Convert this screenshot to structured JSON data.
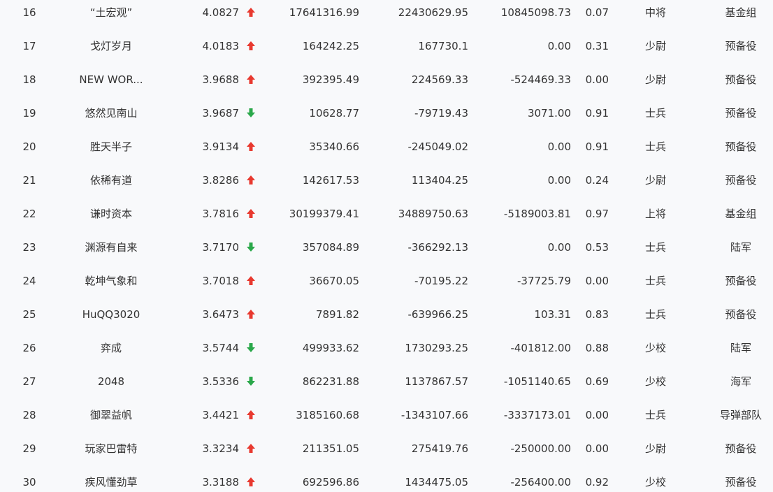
{
  "colors": {
    "up": "#e8392f",
    "down": "#2aa84a"
  },
  "rows": [
    {
      "rank": "16",
      "name": "“土宏观”",
      "score": "4.0827",
      "trend": "up",
      "v1": "17641316.99",
      "v2": "22430629.95",
      "v3": "10845098.73",
      "v4": "0.07",
      "title": "中将",
      "group": "基金组"
    },
    {
      "rank": "17",
      "name": "戈灯岁月",
      "score": "4.0183",
      "trend": "up",
      "v1": "164242.25",
      "v2": "167730.1",
      "v3": "0.00",
      "v4": "0.31",
      "title": "少尉",
      "group": "预备役"
    },
    {
      "rank": "18",
      "name": "NEW WOR...",
      "score": "3.9688",
      "trend": "up",
      "v1": "392395.49",
      "v2": "224569.33",
      "v3": "-524469.33",
      "v4": "0.00",
      "title": "少尉",
      "group": "预备役"
    },
    {
      "rank": "19",
      "name": "悠然见南山",
      "score": "3.9687",
      "trend": "down",
      "v1": "10628.77",
      "v2": "-79719.43",
      "v3": "3071.00",
      "v4": "0.91",
      "title": "士兵",
      "group": "预备役"
    },
    {
      "rank": "20",
      "name": "胜天半子",
      "score": "3.9134",
      "trend": "up",
      "v1": "35340.66",
      "v2": "-245049.02",
      "v3": "0.00",
      "v4": "0.91",
      "title": "士兵",
      "group": "预备役"
    },
    {
      "rank": "21",
      "name": "依稀有道",
      "score": "3.8286",
      "trend": "up",
      "v1": "142617.53",
      "v2": "113404.25",
      "v3": "0.00",
      "v4": "0.24",
      "title": "少尉",
      "group": "预备役"
    },
    {
      "rank": "22",
      "name": "谦时资本",
      "score": "3.7816",
      "trend": "up",
      "v1": "30199379.41",
      "v2": "34889750.63",
      "v3": "-5189003.81",
      "v4": "0.97",
      "title": "上将",
      "group": "基金组"
    },
    {
      "rank": "23",
      "name": "渊源有自来",
      "score": "3.7170",
      "trend": "down",
      "v1": "357084.89",
      "v2": "-366292.13",
      "v3": "0.00",
      "v4": "0.53",
      "title": "士兵",
      "group": "陆军"
    },
    {
      "rank": "24",
      "name": "乾坤气象和",
      "score": "3.7018",
      "trend": "up",
      "v1": "36670.05",
      "v2": "-70195.22",
      "v3": "-37725.79",
      "v4": "0.00",
      "title": "士兵",
      "group": "预备役"
    },
    {
      "rank": "25",
      "name": "HuQQ3020",
      "score": "3.6473",
      "trend": "up",
      "v1": "7891.82",
      "v2": "-639966.25",
      "v3": "103.31",
      "v4": "0.83",
      "title": "士兵",
      "group": "预备役"
    },
    {
      "rank": "26",
      "name": "弈成",
      "score": "3.5744",
      "trend": "down",
      "v1": "499933.62",
      "v2": "1730293.25",
      "v3": "-401812.00",
      "v4": "0.88",
      "title": "少校",
      "group": "陆军"
    },
    {
      "rank": "27",
      "name": "2048",
      "score": "3.5336",
      "trend": "down",
      "v1": "862231.88",
      "v2": "1137867.57",
      "v3": "-1051140.65",
      "v4": "0.69",
      "title": "少校",
      "group": "海军"
    },
    {
      "rank": "28",
      "name": "御翠益帆",
      "score": "3.4421",
      "trend": "up",
      "v1": "3185160.68",
      "v2": "-1343107.66",
      "v3": "-3337173.01",
      "v4": "0.00",
      "title": "士兵",
      "group": "导弹部队"
    },
    {
      "rank": "29",
      "name": "玩家巴雷特",
      "score": "3.3234",
      "trend": "up",
      "v1": "211351.05",
      "v2": "275419.76",
      "v3": "-250000.00",
      "v4": "0.00",
      "title": "少尉",
      "group": "预备役"
    },
    {
      "rank": "30",
      "name": "疾风懂劲草",
      "score": "3.3188",
      "trend": "up",
      "v1": "692596.86",
      "v2": "1434475.05",
      "v3": "-256400.00",
      "v4": "0.92",
      "title": "少校",
      "group": "预备役"
    }
  ]
}
